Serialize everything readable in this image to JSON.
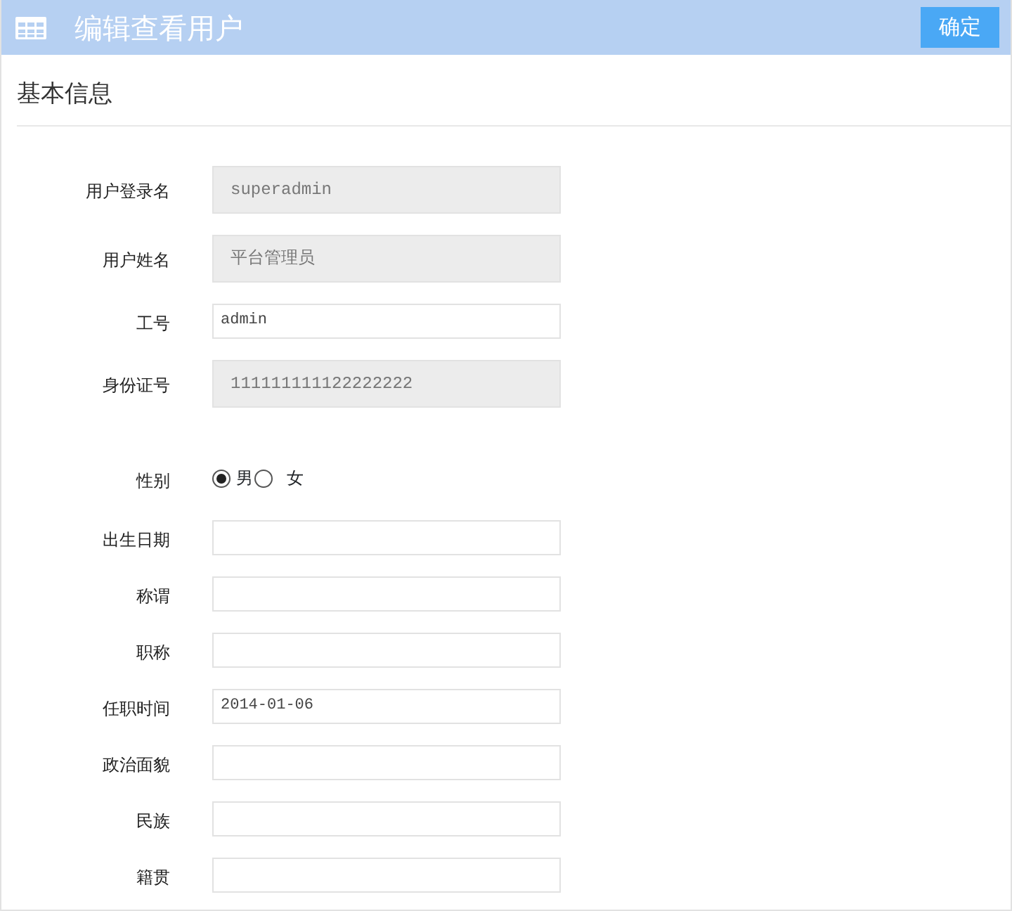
{
  "header": {
    "title": "编辑查看用户",
    "confirm_button": "确定"
  },
  "section": {
    "title": "基本信息"
  },
  "fields": [
    {
      "kind": "text",
      "label": "用户登录名",
      "value": "superadmin",
      "disabled": true
    },
    {
      "kind": "text",
      "label": "用户姓名",
      "value": "平台管理员",
      "disabled": true
    },
    {
      "kind": "text",
      "label": "工号",
      "value": "admin",
      "disabled": false
    },
    {
      "kind": "text",
      "label": "身份证号",
      "value": "111111111122222222",
      "disabled": true
    },
    {
      "kind": "radio",
      "label": "性别",
      "options": [
        {
          "label": "男",
          "selected": true
        },
        {
          "label": "女",
          "selected": false
        }
      ]
    },
    {
      "kind": "text",
      "label": "出生日期",
      "disabled": false
    },
    {
      "kind": "text",
      "label": "称谓",
      "disabled": false
    },
    {
      "kind": "text",
      "label": "职称",
      "disabled": false
    },
    {
      "kind": "text",
      "label": "任职时间",
      "value": "2014-01-06",
      "disabled": false
    },
    {
      "kind": "text",
      "label": "政治面貌",
      "disabled": false
    },
    {
      "kind": "text",
      "label": "民族",
      "disabled": false
    },
    {
      "kind": "text",
      "label": "籍贯",
      "disabled": false
    }
  ]
}
